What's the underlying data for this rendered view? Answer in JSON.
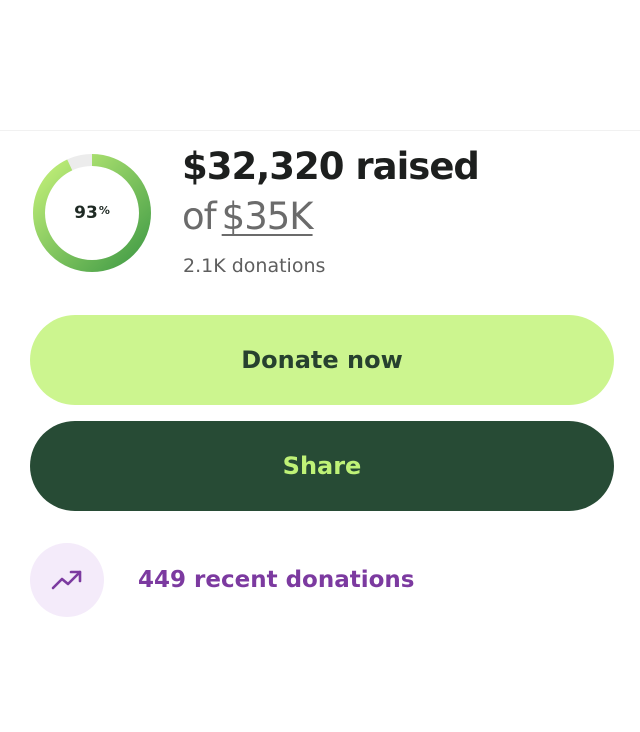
{
  "progress": {
    "percent_value": 93,
    "percent_number": "93",
    "percent_sign": "%",
    "fraction": 0.93,
    "colors": {
      "track": "#ececec",
      "fill_start": "#c6f27a",
      "fill_end": "#3f9a45"
    }
  },
  "summary": {
    "raised_text": "$32,320 raised",
    "goal_prefix": "of",
    "goal_amount": "$35K",
    "donations_count": "2.1K donations"
  },
  "actions": {
    "donate_label": "Donate now",
    "share_label": "Share"
  },
  "recent": {
    "icon": "trending-up-icon",
    "label": "449 recent donations",
    "color": "#7c3aa0"
  }
}
